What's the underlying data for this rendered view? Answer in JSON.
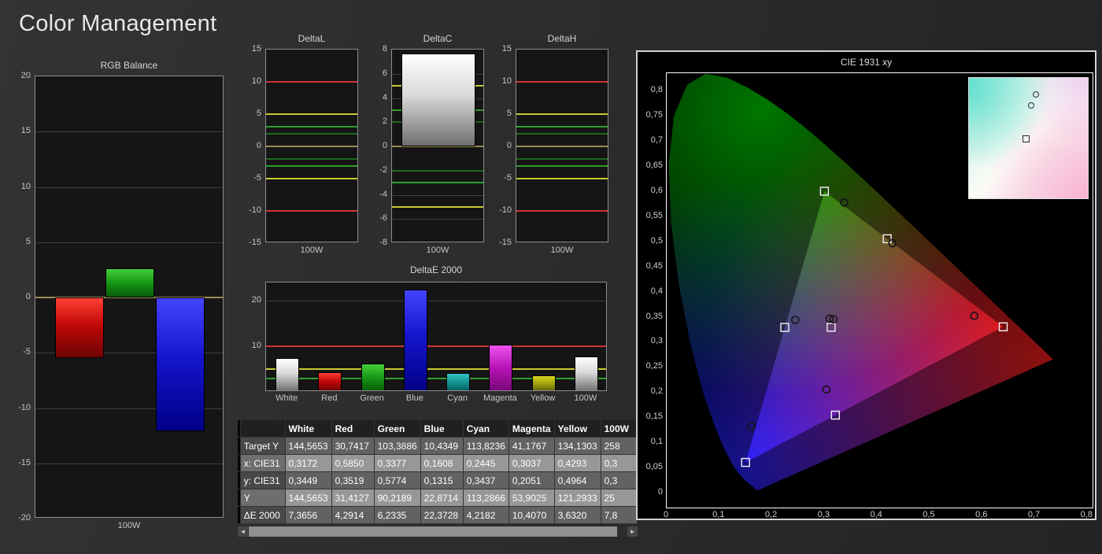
{
  "page": {
    "title": "Color Management"
  },
  "icons": {
    "scroll_left": "◄",
    "scroll_right": "►"
  },
  "colors": {
    "red": "#cf3434",
    "yellow": "#c9c932",
    "green": "#2f9e2f",
    "green_dim": "#1d6a1d",
    "zero_line": "#9b8a55",
    "plot_bg": "#151515",
    "panel_bg": "#000000"
  },
  "chart_data": {
    "rgb_balance": {
      "type": "bar",
      "title": "RGB Balance",
      "xlabel": "100W",
      "ylim": [
        -20,
        20
      ],
      "yticks": [
        20,
        15,
        10,
        5,
        0,
        -5,
        -10,
        -15,
        -20
      ],
      "categories": [
        "100W"
      ],
      "series": [
        {
          "name": "Red",
          "values": [
            -5.5
          ]
        },
        {
          "name": "Green",
          "values": [
            2.6
          ]
        },
        {
          "name": "Blue",
          "values": [
            -12.1
          ]
        }
      ]
    },
    "delta_l": {
      "type": "bar",
      "title": "DeltaL",
      "xlabel": "100W",
      "ylim": [
        -15,
        15
      ],
      "yticks": [
        15,
        10,
        5,
        0,
        -5,
        -10,
        -15
      ],
      "categories": [
        "100W"
      ],
      "values": [],
      "ref_lines": [
        {
          "value": 10,
          "color": "red"
        },
        {
          "value": 5,
          "color": "yellow"
        },
        {
          "value": 3,
          "color": "green"
        },
        {
          "value": 2,
          "color": "green_dim"
        },
        {
          "value": -2,
          "color": "green_dim"
        },
        {
          "value": -3,
          "color": "green"
        },
        {
          "value": -5,
          "color": "yellow"
        },
        {
          "value": -10,
          "color": "red"
        }
      ]
    },
    "delta_c": {
      "type": "bar",
      "title": "DeltaC",
      "xlabel": "100W",
      "ylim": [
        -8,
        8
      ],
      "yticks": [
        8,
        6,
        4,
        2,
        0,
        -2,
        -4,
        -6,
        -8
      ],
      "categories": [
        "100W"
      ],
      "values": [
        7.7
      ],
      "fills": [
        "white"
      ],
      "ref_lines": [
        {
          "value": 5,
          "color": "yellow"
        },
        {
          "value": 3,
          "color": "green"
        },
        {
          "value": 2,
          "color": "green_dim"
        },
        {
          "value": -2,
          "color": "green_dim"
        },
        {
          "value": -3,
          "color": "green"
        },
        {
          "value": -5,
          "color": "yellow"
        }
      ]
    },
    "delta_h": {
      "type": "bar",
      "title": "DeltaH",
      "xlabel": "100W",
      "ylim": [
        -15,
        15
      ],
      "yticks": [
        15,
        10,
        5,
        0,
        -5,
        -10,
        -15
      ],
      "categories": [
        "100W"
      ],
      "values": [],
      "ref_lines": [
        {
          "value": 10,
          "color": "red"
        },
        {
          "value": 5,
          "color": "yellow"
        },
        {
          "value": 3,
          "color": "green"
        },
        {
          "value": 2,
          "color": "green_dim"
        },
        {
          "value": -2,
          "color": "green_dim"
        },
        {
          "value": -3,
          "color": "green"
        },
        {
          "value": -5,
          "color": "yellow"
        },
        {
          "value": -10,
          "color": "red"
        }
      ]
    },
    "delta_e2000": {
      "type": "bar",
      "title": "DeltaE 2000",
      "ylim": [
        0,
        24
      ],
      "yticks": [
        20,
        10
      ],
      "categories": [
        "White",
        "Red",
        "Green",
        "Blue",
        "Cyan",
        "Magenta",
        "Yellow",
        "100W"
      ],
      "values": [
        7.3656,
        4.2914,
        6.2335,
        22.3728,
        4.2182,
        10.407,
        3.632,
        7.8
      ],
      "fills": [
        "white",
        "red",
        "green",
        "blue",
        "cyan",
        "magenta",
        "yellow",
        "white"
      ],
      "ref_lines": [
        {
          "value": 10,
          "color": "red"
        },
        {
          "value": 5,
          "color": "yellow"
        },
        {
          "value": 3,
          "color": "green"
        }
      ]
    },
    "table": {
      "type": "table",
      "columns": [
        "",
        "White",
        "Red",
        "Green",
        "Blue",
        "Cyan",
        "Magenta",
        "Yellow",
        "100W"
      ],
      "rows": [
        {
          "label": "Target Y",
          "values": [
            "144,5653",
            "30,7417",
            "103,3886",
            "10,4349",
            "113,8236",
            "41,1767",
            "134,1303",
            "258"
          ]
        },
        {
          "label": "x: CIE31",
          "values": [
            "0,3172",
            "0,5850",
            "0,3377",
            "0,1608",
            "0,2445",
            "0,3037",
            "0,4293",
            "0,3"
          ]
        },
        {
          "label": "y: CIE31",
          "values": [
            "0,3449",
            "0,3519",
            "0,5774",
            "0,1315",
            "0,3437",
            "0,2051",
            "0,4964",
            "0,3"
          ]
        },
        {
          "label": "Y",
          "values": [
            "144,5653",
            "31,4127",
            "90,2189",
            "22,8714",
            "113,2866",
            "53,9025",
            "121,2933",
            "25"
          ]
        },
        {
          "label": "ΔE 2000",
          "values": [
            "7,3656",
            "4,2914",
            "6,2335",
            "22,3728",
            "4,2182",
            "10,4070",
            "3,6320",
            "7,8"
          ]
        }
      ]
    },
    "cie": {
      "type": "scatter",
      "title": "CIE 1931 xy",
      "xlim": [
        0,
        0.81
      ],
      "ylim": [
        -0.03,
        0.835
      ],
      "xticks": [
        "0",
        "0,1",
        "0,2",
        "0,3",
        "0,4",
        "0,5",
        "0,6",
        "0,7",
        "0,8"
      ],
      "yticks": [
        "0,8",
        "0,75",
        "0,7",
        "0,65",
        "0,6",
        "0,55",
        "0,5",
        "0,45",
        "0,4",
        "0,35",
        "0,3",
        "0,25",
        "0,2",
        "0,15",
        "0,1",
        "0,05",
        "0"
      ],
      "targets": [
        {
          "name": "White",
          "x": 0.3127,
          "y": 0.329
        },
        {
          "name": "Red",
          "x": 0.64,
          "y": 0.33
        },
        {
          "name": "Green",
          "x": 0.3,
          "y": 0.6
        },
        {
          "name": "Blue",
          "x": 0.15,
          "y": 0.06
        },
        {
          "name": "Cyan",
          "x": 0.2246,
          "y": 0.3287
        },
        {
          "name": "Magenta",
          "x": 0.3209,
          "y": 0.1542
        },
        {
          "name": "Yellow",
          "x": 0.4193,
          "y": 0.5053
        }
      ],
      "measured": [
        {
          "name": "White",
          "x": 0.3172,
          "y": 0.3449
        },
        {
          "name": "100W",
          "x": 0.31,
          "y": 0.346
        },
        {
          "name": "Red",
          "x": 0.585,
          "y": 0.3519
        },
        {
          "name": "Green",
          "x": 0.3377,
          "y": 0.5774
        },
        {
          "name": "Blue",
          "x": 0.1608,
          "y": 0.1315
        },
        {
          "name": "Cyan",
          "x": 0.2445,
          "y": 0.3437
        },
        {
          "name": "Magenta",
          "x": 0.3037,
          "y": 0.2051
        },
        {
          "name": "Yellow",
          "x": 0.4293,
          "y": 0.4964
        }
      ],
      "inset": {
        "circles": [
          {
            "x": 0.56,
            "y": 0.14
          },
          {
            "x": 0.52,
            "y": 0.23
          }
        ],
        "squares": [
          {
            "x": 0.48,
            "y": 0.5
          }
        ]
      }
    }
  }
}
